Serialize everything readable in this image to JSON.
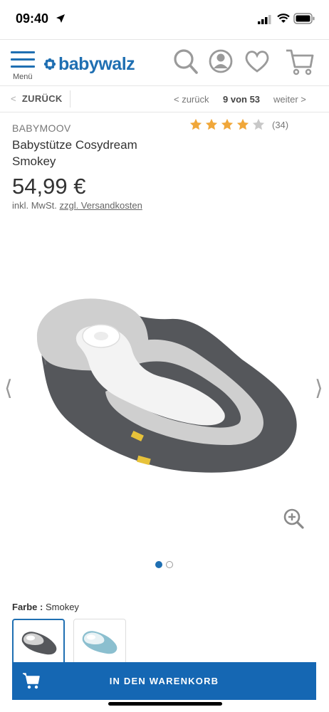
{
  "status_bar": {
    "time": "09:40"
  },
  "header": {
    "menu_label": "Menü",
    "logo_text": "babywalz",
    "brand_color": "#1f6fb2"
  },
  "nav": {
    "back_label": "ZURÜCK",
    "prev_label": "< zurück",
    "page_count": "9 von 53",
    "next_label": "weiter >"
  },
  "product": {
    "brand": "BABYMOOV",
    "title": "Babystütze Cosydream Smokey",
    "rating": {
      "stars": 4,
      "max": 5,
      "count": "(34)"
    },
    "price": "54,99 €",
    "tax_note": "inkl. MwSt.",
    "shipping_link": "zzgl. Versandkosten"
  },
  "gallery": {
    "current": 1,
    "total": 2
  },
  "color": {
    "label": "Farbe :",
    "value": "Smokey",
    "options": [
      "smokey-grey",
      "light-blue"
    ]
  },
  "cart": {
    "button_label": "IN DEN WARENKORB",
    "color": "#1567b3"
  },
  "icons": [
    "location-arrow-icon",
    "signal-icon",
    "wifi-icon",
    "battery-icon",
    "menu-icon",
    "search-icon",
    "user-icon",
    "heart-icon",
    "cart-icon",
    "star-icon",
    "zoom-icon",
    "chevron-left-icon",
    "chevron-right-icon"
  ]
}
